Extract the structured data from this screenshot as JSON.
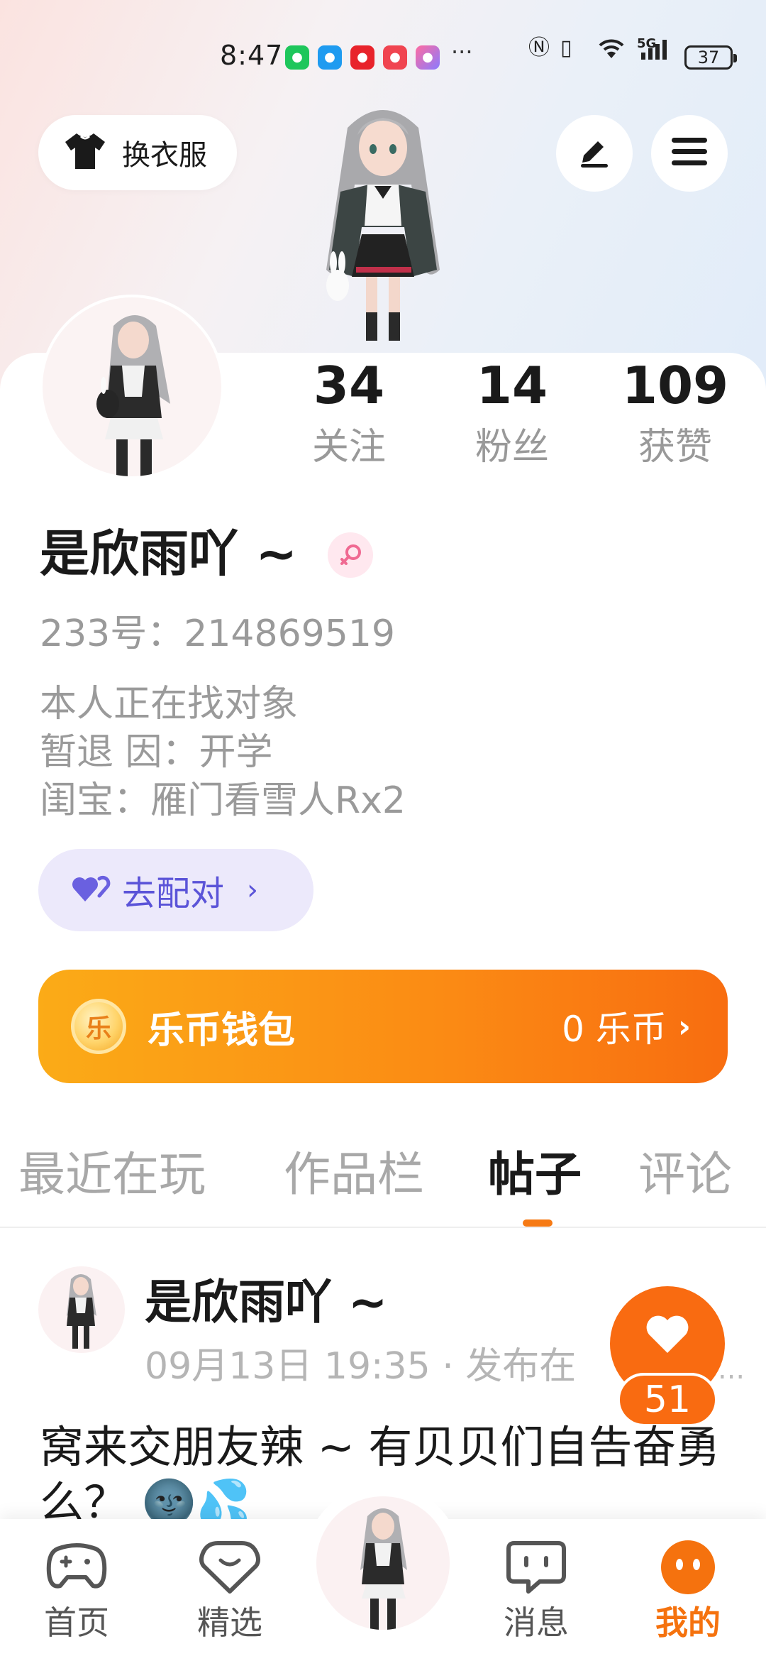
{
  "status_bar": {
    "time": "8:47",
    "more": "···",
    "network": "5G",
    "battery": "37",
    "app_icons": [
      "wechat-icon",
      "message-icon",
      "reading-app-icon",
      "huawei-store-icon",
      "app-icon"
    ]
  },
  "header": {
    "dressup_label": "换衣服"
  },
  "profile": {
    "stats": [
      {
        "value": "34",
        "label": "关注"
      },
      {
        "value": "14",
        "label": "粉丝"
      },
      {
        "value": "109",
        "label": "获赞"
      }
    ],
    "name": "是欣雨吖 ~",
    "gender_icon": "female-icon",
    "account_id": "233号：214869519",
    "bio": [
      "本人正在找对象",
      "暂退 因：开学",
      "闺宝：雁门看雪人Rx2"
    ],
    "match_label": "去配对",
    "match_chevron": "›"
  },
  "wallet": {
    "coin_glyph": "乐",
    "label": "乐币钱包",
    "value": "0 乐币",
    "chevron": "›"
  },
  "tabs": [
    "最近在玩",
    "作品栏",
    "帖子",
    "评论"
  ],
  "active_tab": "帖子",
  "post": {
    "author": "是欣雨吖 ~",
    "meta": "09月13日 19:35 · 发布在",
    "more": "...",
    "likes": "51",
    "text": "窝来交朋友辣 ~ 有贝贝们自告奋勇么？ 🌚💦"
  },
  "bottom_nav": [
    {
      "label": "首页",
      "icon": "gamepad-icon"
    },
    {
      "label": "精选",
      "icon": "heart-chat-icon"
    },
    {
      "label": "",
      "icon": "avatar"
    },
    {
      "label": "消息",
      "icon": "chat-bubble-icon"
    },
    {
      "label": "我的",
      "icon": "profile-face-icon"
    }
  ],
  "colors": {
    "accent_orange": "#f96b11",
    "match_purple": "#5b54d8",
    "match_bg": "#ece9fb",
    "muted_text": "#9a9a9a"
  }
}
